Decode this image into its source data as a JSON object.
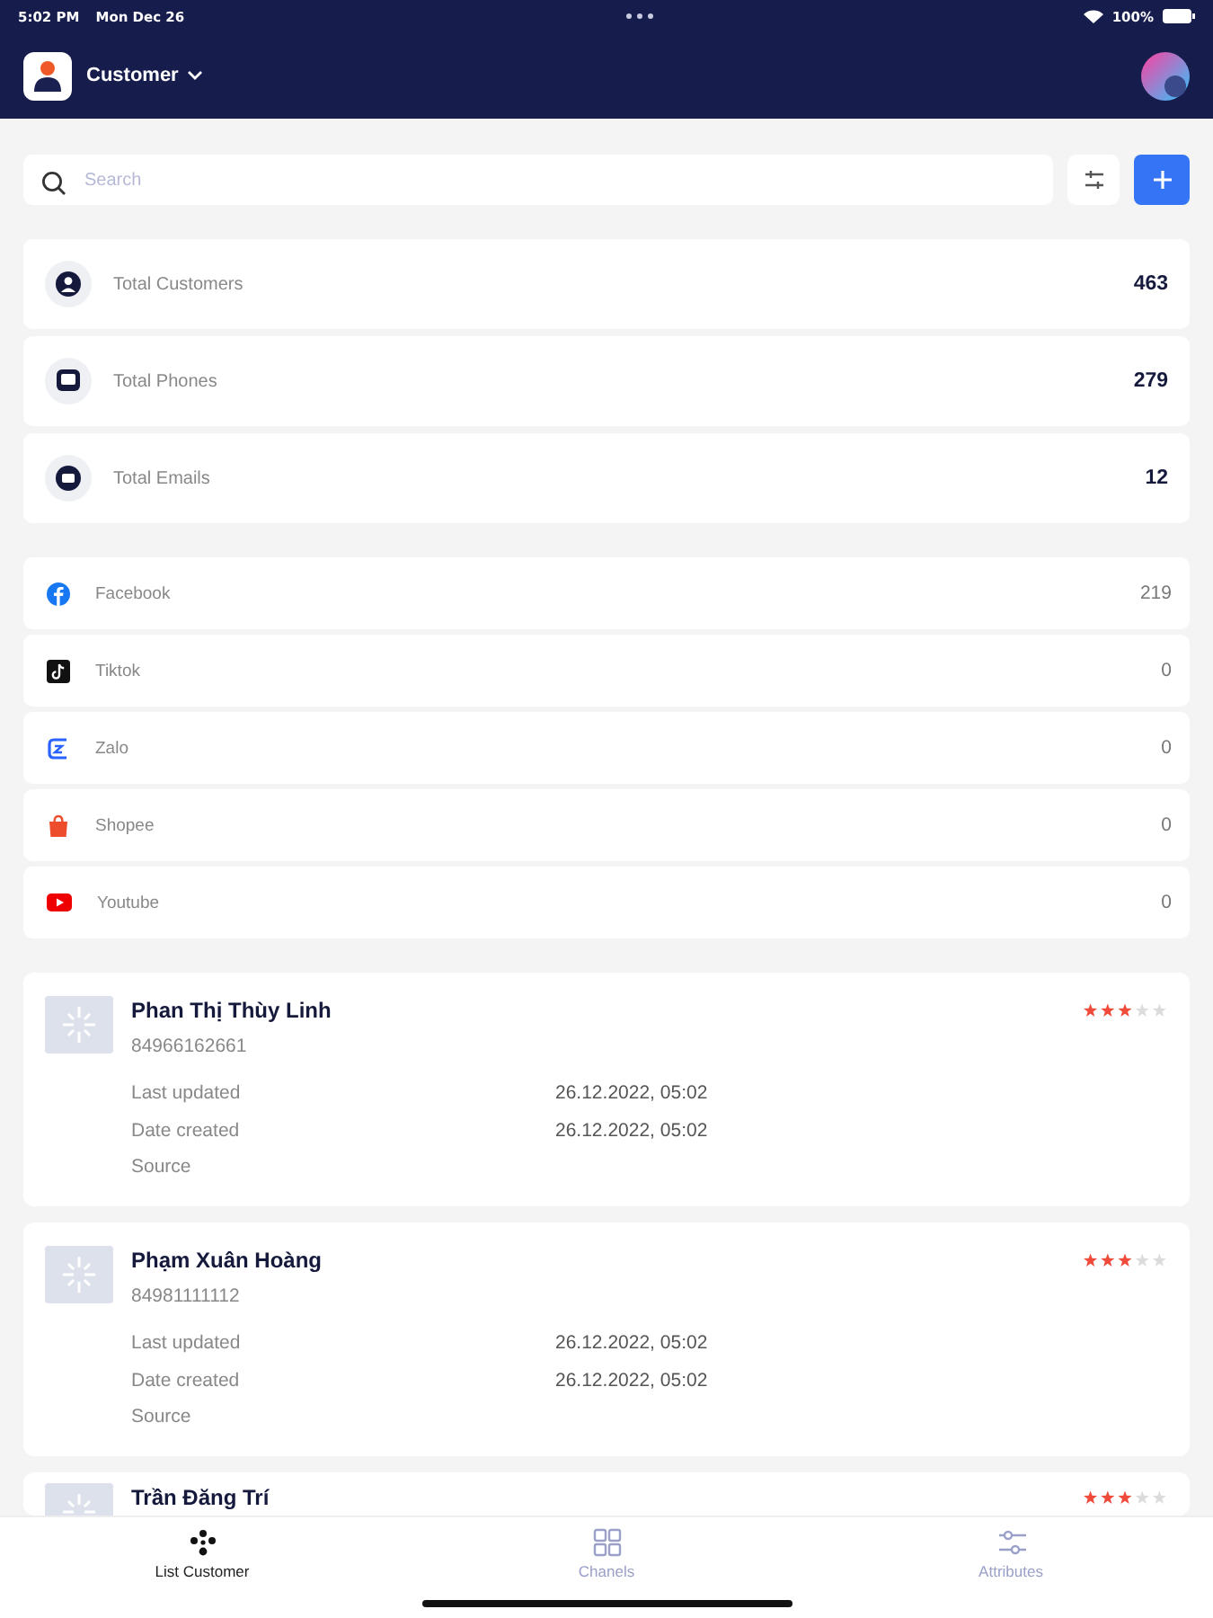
{
  "status_bar": {
    "time": "5:02 PM",
    "date": "Mon Dec 26",
    "battery": "100%"
  },
  "header": {
    "title": "Customer"
  },
  "search": {
    "placeholder": "Search"
  },
  "stats": [
    {
      "kind": "customers",
      "label": "Total Customers",
      "value": "463"
    },
    {
      "kind": "phones",
      "label": "Total Phones",
      "value": "279"
    },
    {
      "kind": "emails",
      "label": "Total Emails",
      "value": "12"
    }
  ],
  "channels": [
    {
      "kind": "facebook",
      "label": "Facebook",
      "value": "219"
    },
    {
      "kind": "tiktok",
      "label": "Tiktok",
      "value": "0"
    },
    {
      "kind": "zalo",
      "label": "Zalo",
      "value": "0"
    },
    {
      "kind": "shopee",
      "label": "Shopee",
      "value": "0"
    },
    {
      "kind": "youtube",
      "label": "Youtube",
      "value": "0"
    }
  ],
  "customers": [
    {
      "name": "Phan Thị Thùy Linh",
      "phone": "84966162661",
      "stars": 3,
      "fields": [
        {
          "label": "Last updated",
          "value": "26.12.2022, 05:02"
        },
        {
          "label": "Date created",
          "value": "26.12.2022, 05:02"
        },
        {
          "label": "Source"
        }
      ]
    },
    {
      "name": "Phạm Xuân Hoàng",
      "phone": "84981111112",
      "stars": 3,
      "fields": [
        {
          "label": "Last updated",
          "value": "26.12.2022, 05:02"
        },
        {
          "label": "Date created",
          "value": "26.12.2022, 05:02"
        },
        {
          "label": "Source"
        }
      ]
    },
    {
      "name": "Trần Đăng Trí",
      "stars": 3
    }
  ],
  "tabs": [
    {
      "kind": "list",
      "label": "List Customer",
      "selected": true
    },
    {
      "kind": "channels",
      "label": "Chanels",
      "selected": false
    },
    {
      "kind": "attributes",
      "label": "Attributes",
      "selected": false
    }
  ]
}
